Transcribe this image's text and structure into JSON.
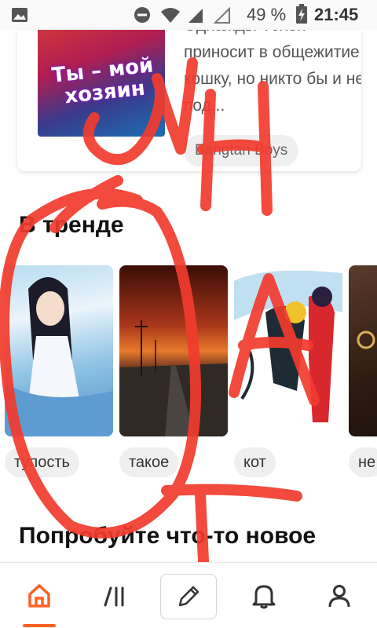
{
  "status_bar": {
    "battery_percent": "49 %",
    "time": "21:45"
  },
  "story_card": {
    "cover_title": "Ты – мой хозяин",
    "description": "Однажды Тэхён приносит в общежитие кошку, но никто бы и не под...",
    "tag": "Bangtan Boys"
  },
  "trending": {
    "title": "В тренде",
    "items": [
      {
        "tag": "тупость",
        "image": "anime-girl-image"
      },
      {
        "tag": "такое",
        "image": "sunset-road-image"
      },
      {
        "tag": "кот",
        "image": "ladybug-catnoir-image"
      },
      {
        "tag": "не",
        "image": "face-closeup-image"
      }
    ]
  },
  "next_section": {
    "title": "Попробуйте что-то новое"
  },
  "bottom_nav": {
    "items": [
      "home-icon",
      "library-icon",
      "write-icon",
      "notifications-icon",
      "profile-icon"
    ],
    "active_color": "#ff6122"
  },
  "annotation": {
    "text": "WHAT",
    "color": "#f23b2e"
  }
}
